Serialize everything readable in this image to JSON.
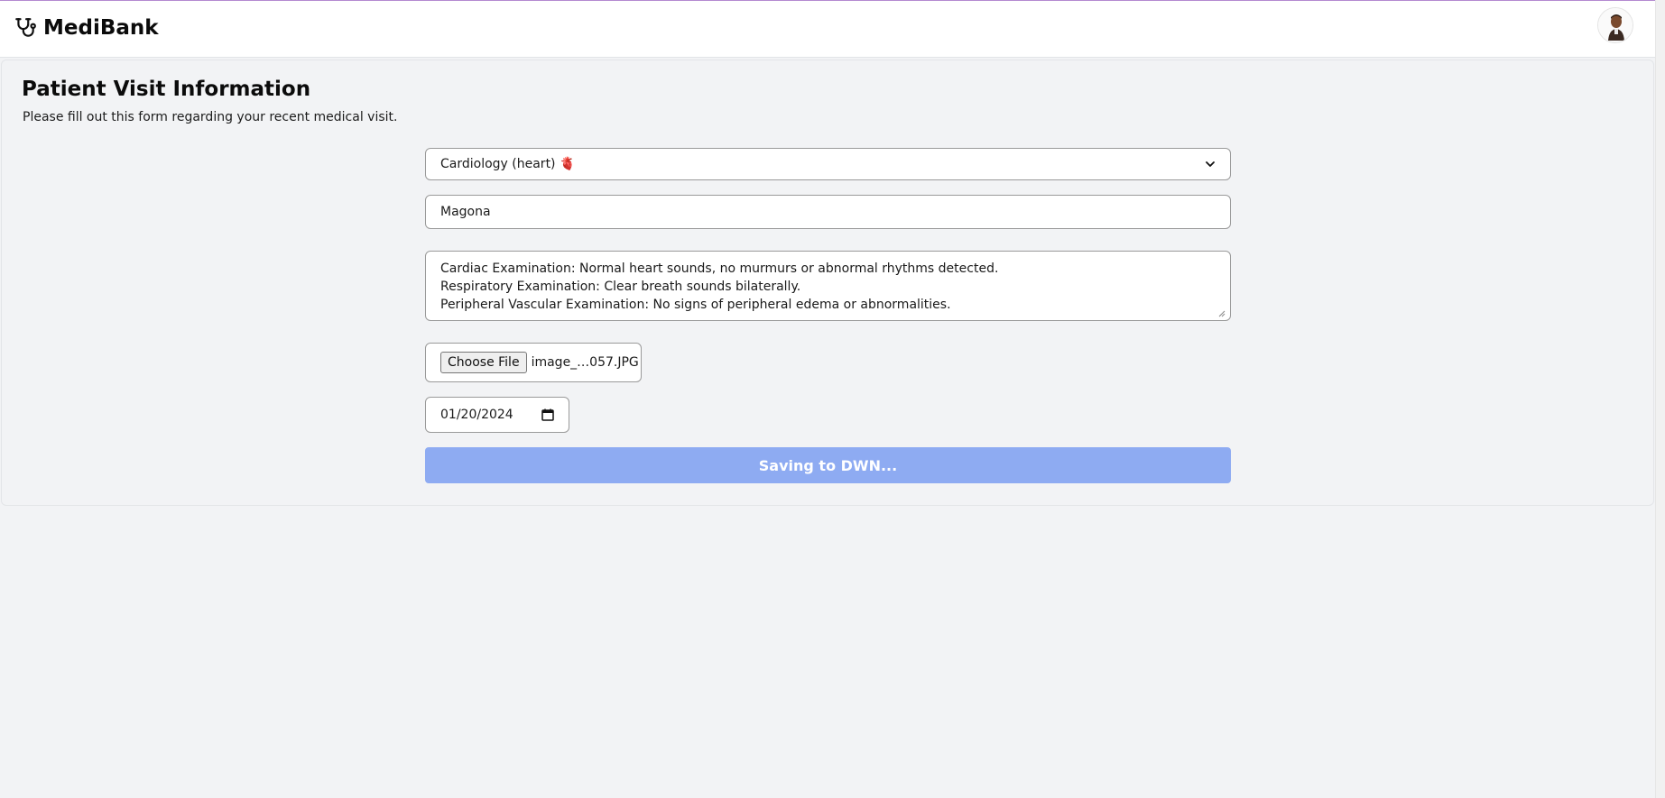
{
  "app": {
    "name": "MediBank"
  },
  "header": {
    "avatar_icon": "user-avatar"
  },
  "page": {
    "title": "Patient Visit Information",
    "subtitle": "Please fill out this form regarding your recent medical visit."
  },
  "form": {
    "specialty_selected": "Cardiology (heart) 🫀",
    "doctor_name": "Magona",
    "notes": "Cardiac Examination: Normal heart sounds, no murmurs or abnormal rhythms detected.\nRespiratory Examination: Clear breath sounds bilaterally.\nPeripheral Vascular Examination: No signs of peripheral edema or abnormalities.",
    "file_button_label": "Choose File",
    "file_name": "image_…057.JPG",
    "visit_date": "01/20/2024",
    "submit_label": "Saving to DWN..."
  },
  "colors": {
    "accent_button": "#8eabf2",
    "top_border": "#b48ad0",
    "page_background": "#f2f3f5"
  }
}
